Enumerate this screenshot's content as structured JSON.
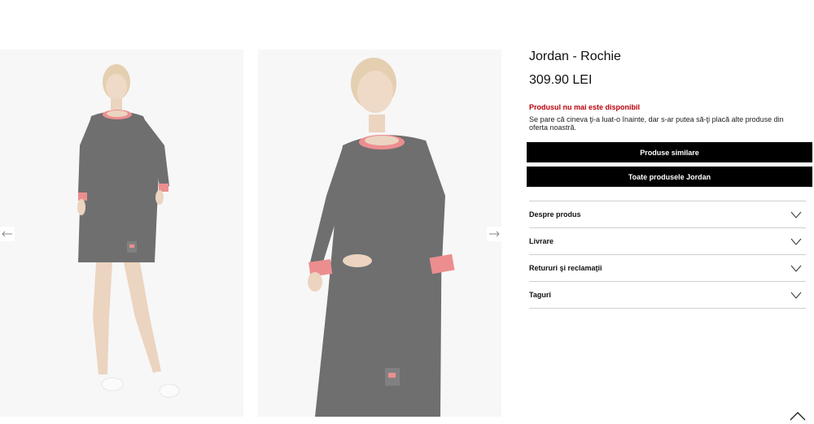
{
  "gallery": {
    "images": [
      {
        "alt": "dress-front-view"
      },
      {
        "alt": "dress-angled-view"
      }
    ],
    "prev_icon": "arrow-left-icon",
    "next_icon": "arrow-right-icon"
  },
  "product": {
    "title": "Jordan - Rochie",
    "price": "309.90 LEI",
    "availability_title": "Produsul nu mai este disponibil",
    "availability_message": "Se pare că cineva ţi-a luat-o înainte, dar s-ar putea să-ţi placă alte produse din oferta noastră."
  },
  "actions": {
    "similar_label": "Produse similare",
    "all_brand_label": "Toate produsele Jordan"
  },
  "accordion": {
    "items": [
      {
        "label": "Despre produs"
      },
      {
        "label": "Livrare"
      },
      {
        "label": "Retururi şi reclamaţii"
      },
      {
        "label": "Taguri"
      }
    ],
    "chevron_icon": "chevron-down-icon"
  },
  "scroll_top_icon": "chevron-up-icon",
  "colors": {
    "accent_red": "#b8000a",
    "button_bg": "#000000",
    "dress": "#2b2b2b",
    "trim": "#e4595c"
  }
}
